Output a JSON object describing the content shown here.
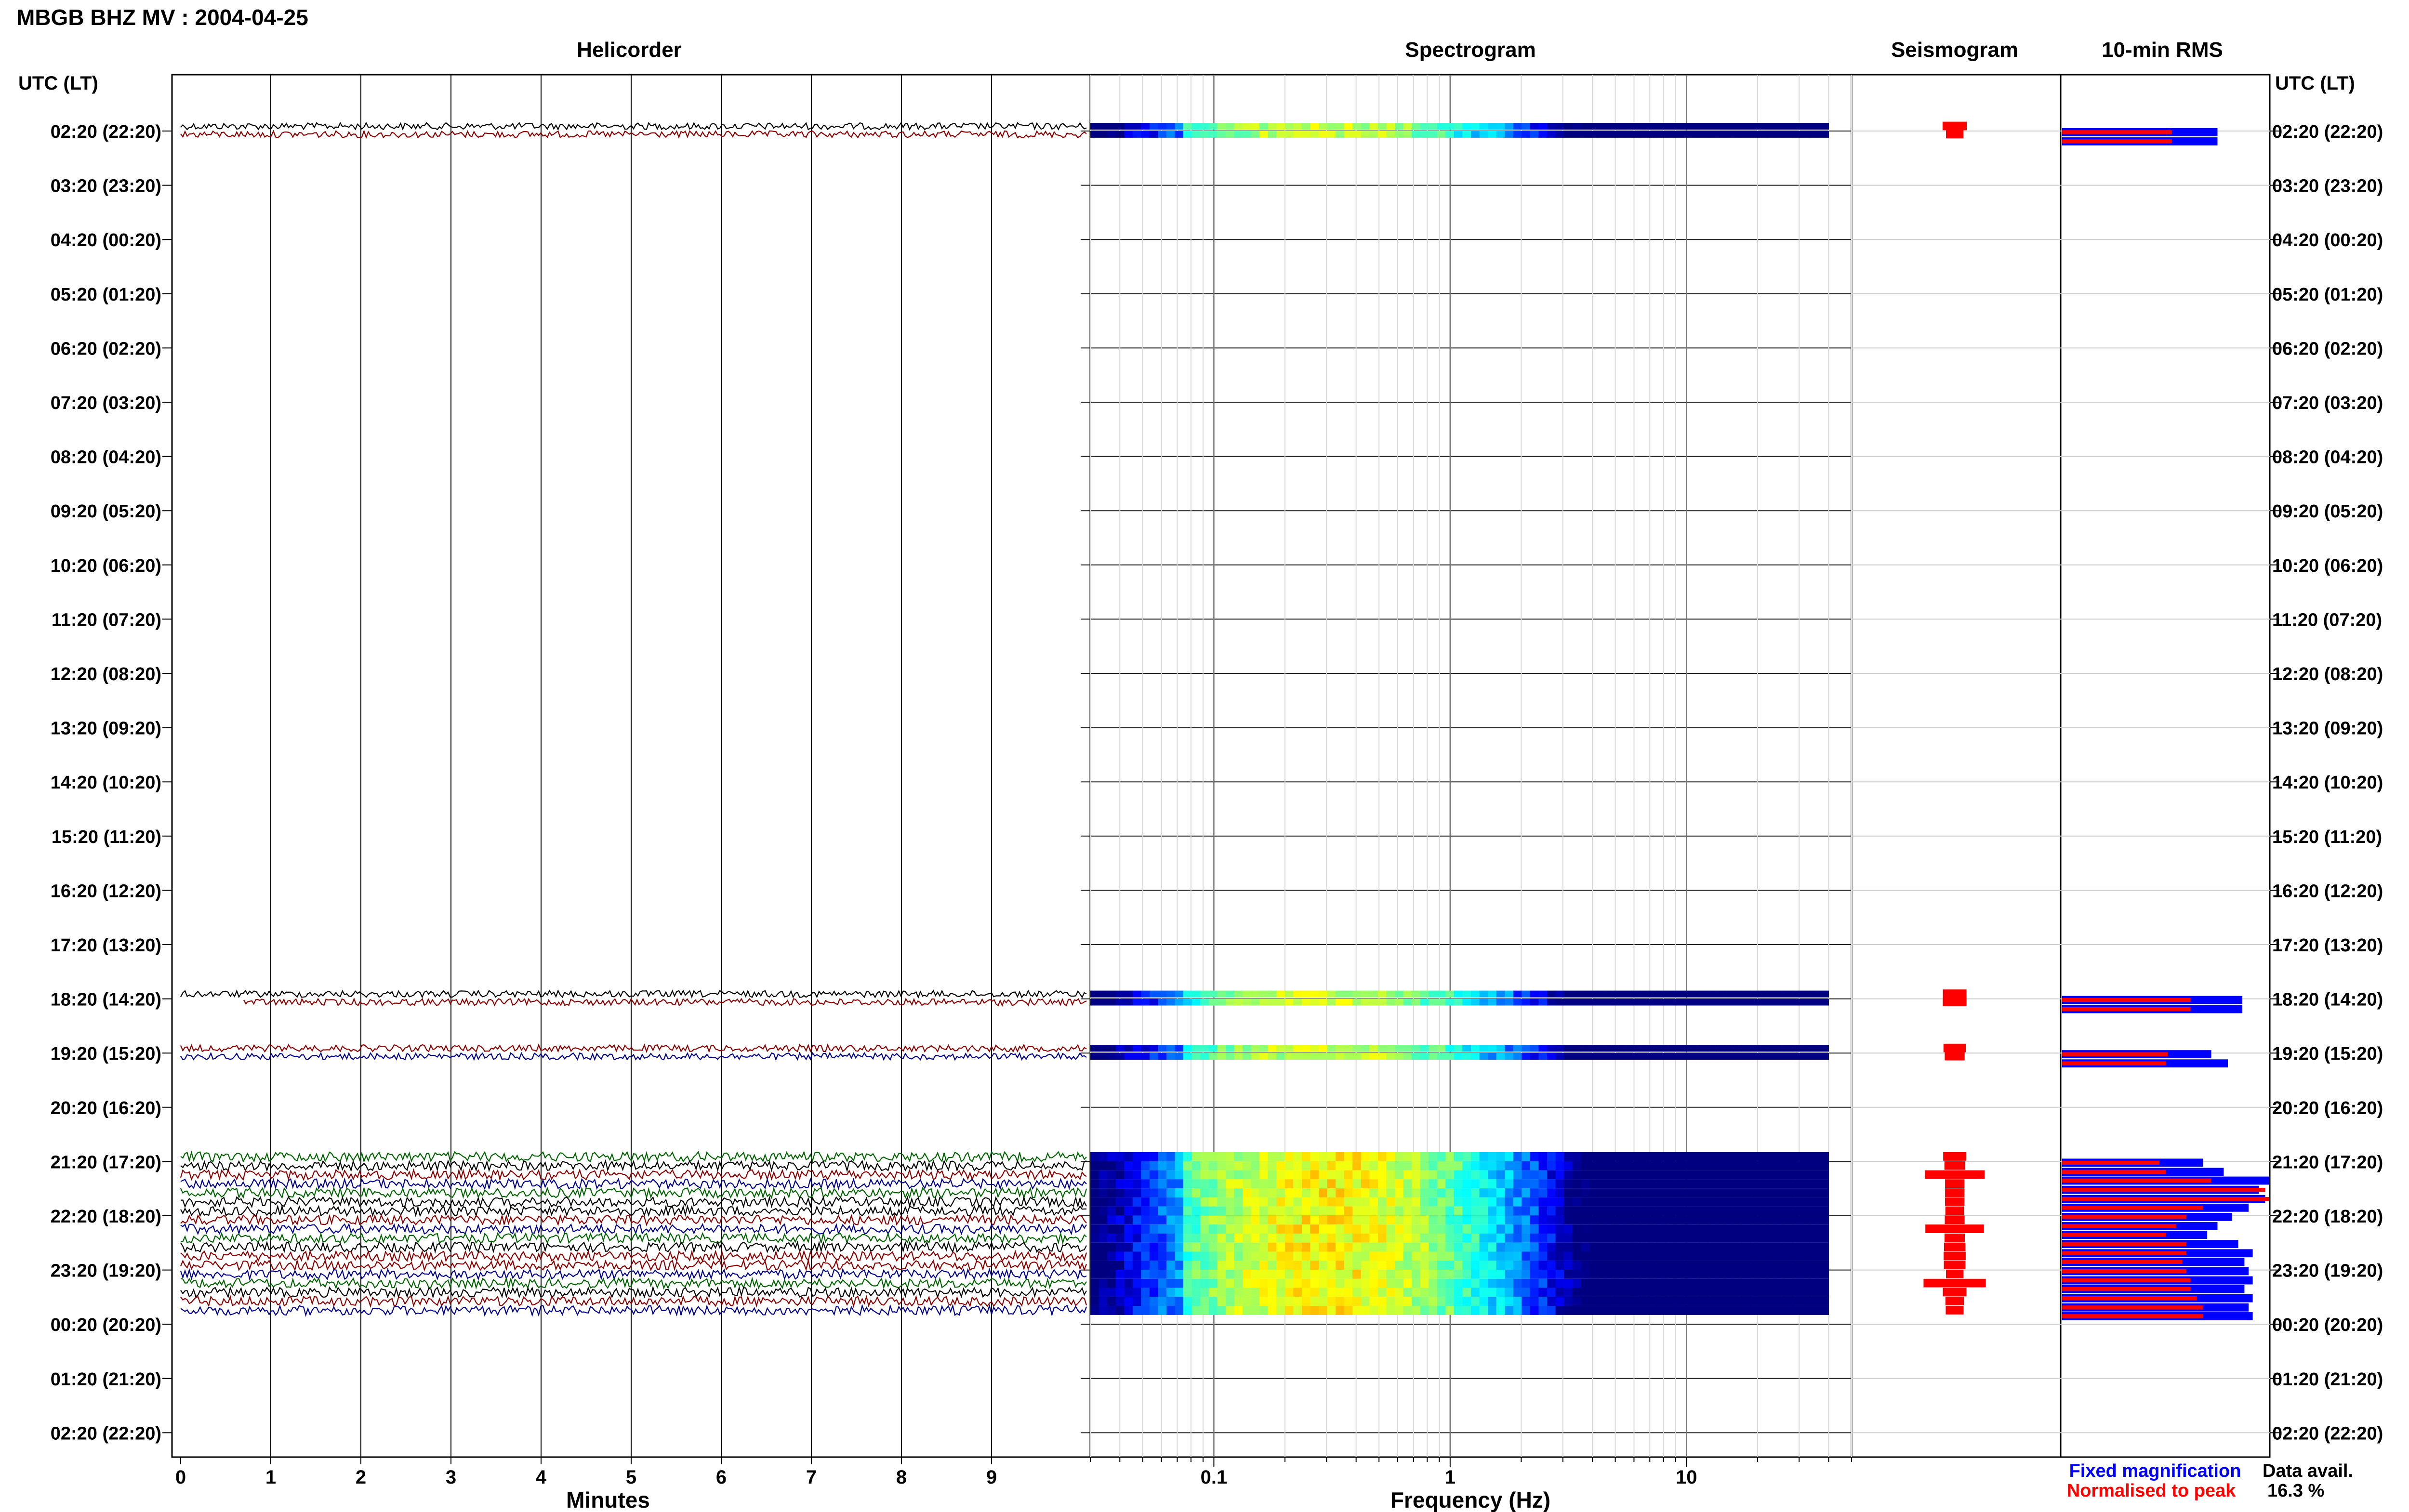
{
  "header": {
    "title": "MBGB BHZ MV : 2004-04-25"
  },
  "panels": {
    "helicorder": "Helicorder",
    "spectrogram": "Spectrogram",
    "seismogram": "Seismogram",
    "rms": "10-min RMS"
  },
  "axes": {
    "left_header": "UTC (LT)",
    "right_header": "UTC (LT)",
    "x_helicorder": "Minutes",
    "x_spectrogram": "Frequency (Hz)"
  },
  "legend": {
    "fixed": "Fixed magnification",
    "normalised": "Normalised to peak",
    "fixed_color": "#0000ff",
    "normalised_color": "#ff0000"
  },
  "data_availability": {
    "label": "Data avail.",
    "value": "16.3 %"
  },
  "chart_data": {
    "type": "heatmap",
    "time_labels": [
      "02:20 (22:20)",
      "03:20 (23:20)",
      "04:20 (00:20)",
      "05:20 (01:20)",
      "06:20 (02:20)",
      "07:20 (03:20)",
      "08:20 (04:20)",
      "09:20 (05:20)",
      "10:20 (06:20)",
      "11:20 (07:20)",
      "12:20 (08:20)",
      "13:20 (09:20)",
      "14:20 (10:20)",
      "15:20 (11:20)",
      "16:20 (12:20)",
      "17:20 (13:20)",
      "18:20 (14:20)",
      "19:20 (15:20)",
      "20:20 (16:20)",
      "21:20 (17:20)",
      "22:20 (18:20)",
      "23:20 (19:20)",
      "00:20 (20:20)",
      "01:20 (21:20)",
      "02:20 (22:20)"
    ],
    "minutes_ticks": [
      "0",
      "1",
      "2",
      "3",
      "4",
      "5",
      "6",
      "7",
      "8",
      "9"
    ],
    "minutes_range": [
      0,
      10
    ],
    "freq_ticks": [
      "0.1",
      "1",
      "10"
    ],
    "freq_range": [
      0.03,
      50
    ],
    "freq_scale": "log",
    "trace_colors": [
      "#000000",
      "#8b0000",
      "#00008b",
      "#006400"
    ],
    "data_hours": [
      0,
      16,
      17,
      19,
      20,
      21
    ],
    "data_segments_per_hour": {
      "0": 2,
      "16": 2,
      "17": 2,
      "19": 6,
      "20": 6,
      "21": 6
    },
    "rms": [
      {
        "hour": 0.0,
        "fixed": 0.75,
        "normalised": 0.53
      },
      {
        "hour": 0.17,
        "fixed": 0.75,
        "normalised": 0.53
      },
      {
        "hour": 16.0,
        "fixed": 0.87,
        "normalised": 0.62
      },
      {
        "hour": 16.17,
        "fixed": 0.87,
        "normalised": 0.62
      },
      {
        "hour": 17.0,
        "fixed": 0.72,
        "normalised": 0.51
      },
      {
        "hour": 17.17,
        "fixed": 0.8,
        "normalised": 0.5
      },
      {
        "hour": 19.0,
        "fixed": 0.68,
        "normalised": 0.47
      },
      {
        "hour": 19.17,
        "fixed": 0.78,
        "normalised": 0.5
      },
      {
        "hour": 19.33,
        "fixed": 1.0,
        "normalised": 0.72
      },
      {
        "hour": 19.5,
        "fixed": 0.95,
        "normalised": 0.98
      },
      {
        "hour": 19.67,
        "fixed": 0.98,
        "normalised": 1.0
      },
      {
        "hour": 19.83,
        "fixed": 0.9,
        "normalised": 0.68
      },
      {
        "hour": 20.0,
        "fixed": 0.82,
        "normalised": 0.6
      },
      {
        "hour": 20.17,
        "fixed": 0.75,
        "normalised": 0.55
      },
      {
        "hour": 20.33,
        "fixed": 0.7,
        "normalised": 0.5
      },
      {
        "hour": 20.5,
        "fixed": 0.85,
        "normalised": 0.6
      },
      {
        "hour": 20.67,
        "fixed": 0.92,
        "normalised": 0.6
      },
      {
        "hour": 20.83,
        "fixed": 0.88,
        "normalised": 0.58
      },
      {
        "hour": 21.0,
        "fixed": 0.9,
        "normalised": 0.6
      },
      {
        "hour": 21.17,
        "fixed": 0.92,
        "normalised": 0.62
      },
      {
        "hour": 21.33,
        "fixed": 0.88,
        "normalised": 0.62
      },
      {
        "hour": 21.5,
        "fixed": 0.92,
        "normalised": 0.65
      },
      {
        "hour": 21.67,
        "fixed": 0.9,
        "normalised": 0.68
      },
      {
        "hour": 21.83,
        "fixed": 0.92,
        "normalised": 0.68
      }
    ]
  }
}
